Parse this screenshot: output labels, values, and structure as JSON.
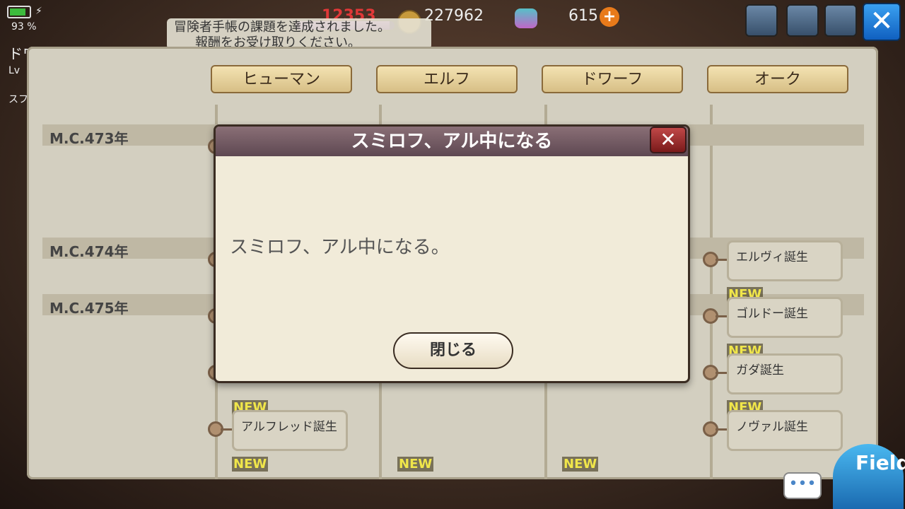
{
  "hud": {
    "battery_pct": "93 %",
    "stamina": "12353",
    "stamina_fraction": 0.95,
    "gold": "227962",
    "gems": "615",
    "plus": "+",
    "close": "✕"
  },
  "notice": {
    "line1": "冒険者手帳の課題を達成されました。",
    "line2": "報酬をお受け取りください。"
  },
  "side": {
    "label1": "ドワーフ",
    "label2": "Lv",
    "label3": "スフ"
  },
  "tabs": [
    "ヒューマン",
    "エルフ",
    "ドワーフ",
    "オーク"
  ],
  "years": [
    "M.C.473年",
    "M.C.474年",
    "M.C.475年"
  ],
  "events": [
    {
      "label": "エルヴィ誕生"
    },
    {
      "label": "ゴルドー誕生"
    },
    {
      "label": "ガダ誕生"
    },
    {
      "label": "ノヴァル誕生"
    },
    {
      "label": "アルフレッド誕生"
    }
  ],
  "new_label": "NEW",
  "dialog": {
    "title": "スミロフ、アル中になる",
    "body": "スミロフ、アル中になる。",
    "close_button": "閉じる",
    "close_icon": "✕"
  },
  "bottom": {
    "chat": "•••",
    "field": "Field"
  }
}
